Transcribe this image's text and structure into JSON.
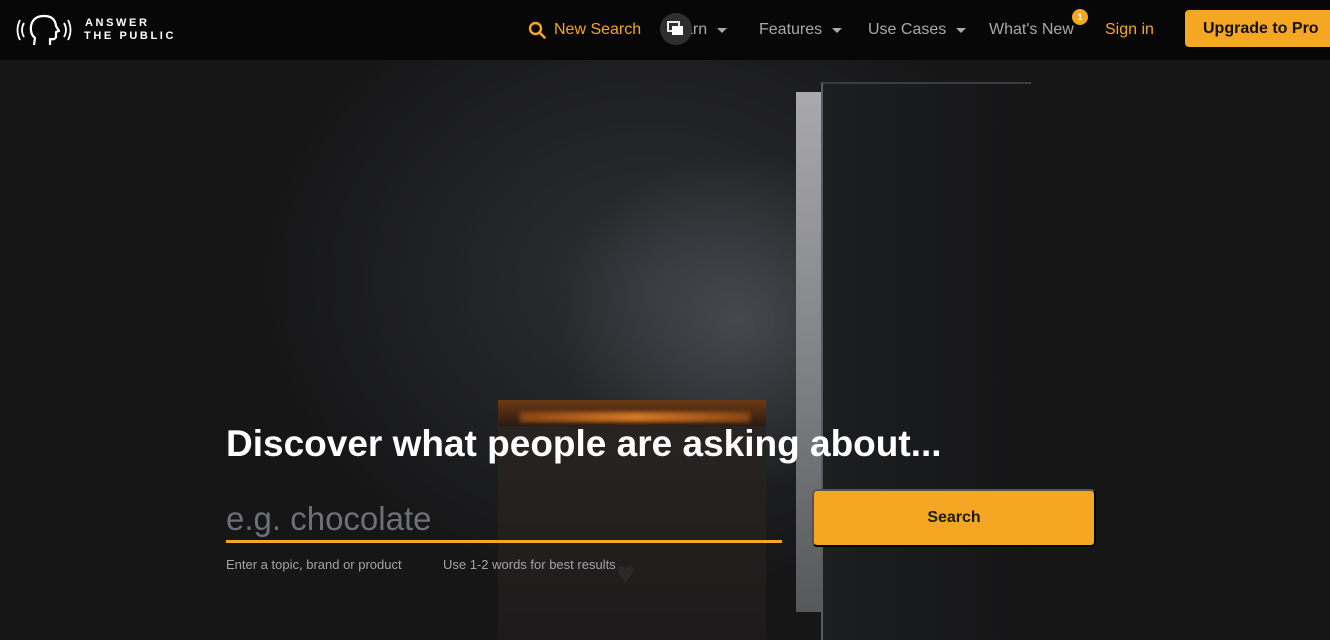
{
  "brand": {
    "line1": "ANSWER",
    "line2": "THE PUBLIC"
  },
  "nav": {
    "new_search": "New Search",
    "learn": "arn",
    "features": "Features",
    "use_cases": "Use Cases",
    "whats_new": "What's New",
    "whats_new_badge": "1",
    "sign_in": "Sign in",
    "upgrade": "Upgrade to Pro"
  },
  "hero": {
    "headline": "Discover what people are asking about...",
    "search_placeholder": "e.g. chocolate",
    "search_button": "Search",
    "hint_left": "Enter a topic, brand or product",
    "hint_right": "Use 1-2 words for best results"
  },
  "colors": {
    "accent": "#f5a623",
    "nav_bg": "#070707",
    "nav_text": "#a9a9a9"
  },
  "icons": {
    "logo": "speaking-head-icon",
    "new_search": "search-icon",
    "overlay": "picture-in-picture-icon",
    "dropdown": "caret-down-icon"
  }
}
